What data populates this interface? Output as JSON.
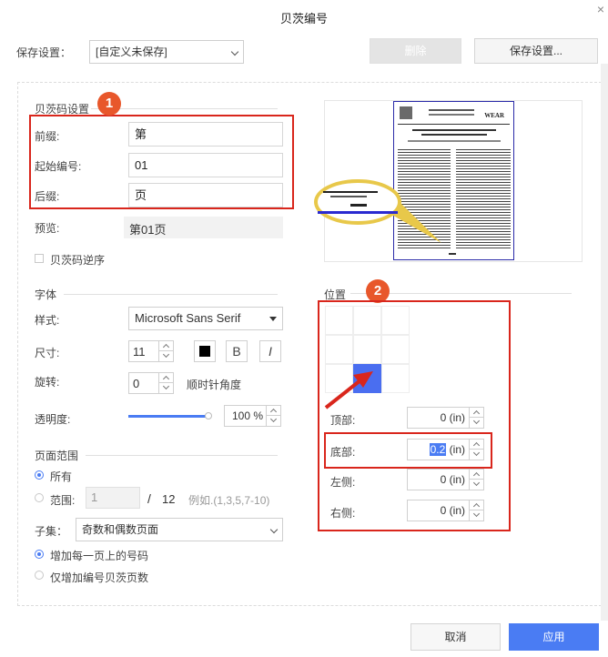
{
  "window": {
    "title": "贝茨编号",
    "close": "×"
  },
  "save_settings": {
    "label": "保存设置：",
    "selected": "[自定义未保存]",
    "delete_label": "删除",
    "save_label": "保存设置..."
  },
  "bates": {
    "section": "贝茨码设置",
    "prefix_label": "前缀:",
    "prefix_value": "第",
    "start_label": "起始编号:",
    "start_value": "01",
    "suffix_label": "后缀:",
    "suffix_value": "页",
    "preview_label": "预览:",
    "preview_value": "第01页",
    "reverse_label": "贝茨码逆序"
  },
  "font": {
    "section": "字体",
    "style_label": "样式:",
    "style_value": "Microsoft Sans Serif",
    "size_label": "尺寸:",
    "size_value": "11",
    "bold": "B",
    "italic": "I",
    "rotation_label": "旋转:",
    "rotation_value": "0",
    "rotation_unit": "顺时针角度",
    "opacity_label": "透明度:",
    "opacity_value": "100 %",
    "opacity_fraction": 1.0
  },
  "page_range": {
    "section": "页面范围",
    "all_label": "所有",
    "range_label": "范围:",
    "range_value": "1",
    "range_sep": "/",
    "range_total": "12",
    "range_example": "例如.(1,3,5,7-10)",
    "subset_label": "子集：",
    "subset_value": "奇数和偶数页面",
    "add_each_label": "增加每一页上的号码",
    "add_only_label": "仅增加编号贝茨页数"
  },
  "position": {
    "section": "位置",
    "top_label": "顶部:",
    "top_value": "0",
    "top_unit": "(in)",
    "bottom_label": "底部:",
    "bottom_value": "0.2",
    "bottom_unit": "(in)",
    "left_label": "左侧:",
    "left_value": "0",
    "left_unit": "(in)",
    "right_label": "右侧:",
    "right_value": "0",
    "right_unit": "(in)"
  },
  "badges": {
    "one": "1",
    "two": "2"
  },
  "preview_doc": {
    "journal": "WEAR"
  },
  "footer": {
    "cancel": "取消",
    "apply": "应用"
  },
  "colors": {
    "accent": "#4a7cf3",
    "annotation_red": "#d9261c",
    "badge_orange": "#e8572b"
  }
}
